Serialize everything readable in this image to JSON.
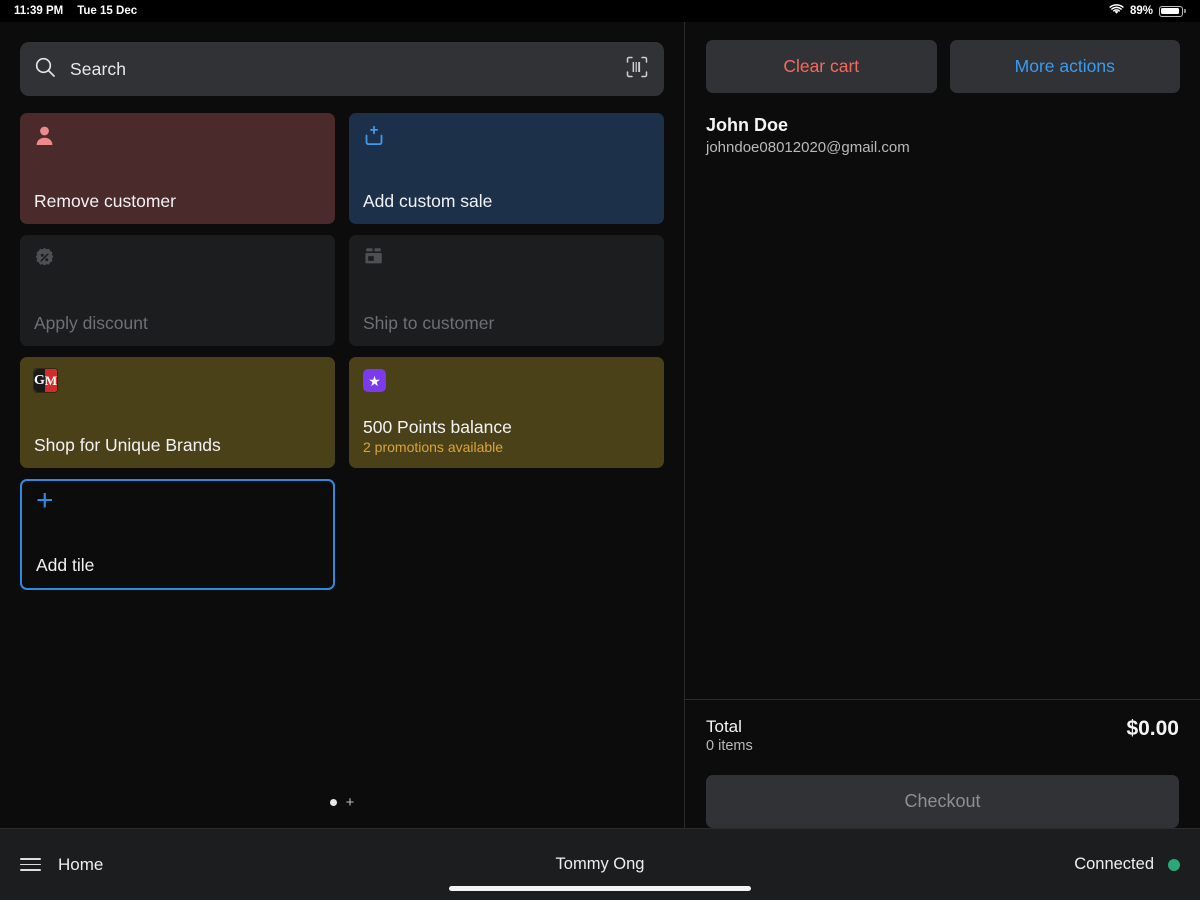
{
  "status_bar": {
    "time": "11:39 PM",
    "date": "Tue 15 Dec",
    "battery_percent": "89%",
    "wifi_icon": "wifi-icon",
    "battery_icon": "battery-icon"
  },
  "search": {
    "placeholder": "Search",
    "value": "",
    "search_icon": "search-icon",
    "scan_icon": "barcode-scan-icon"
  },
  "tiles": [
    {
      "id": "remove-customer",
      "label": "Remove customer",
      "sublabel": "",
      "icon": "person-icon",
      "bg": "#4a2a2a",
      "enabled": true
    },
    {
      "id": "add-custom-sale",
      "label": "Add custom sale",
      "sublabel": "",
      "icon": "add-to-cart-icon",
      "bg": "#1c3149",
      "enabled": true
    },
    {
      "id": "apply-discount",
      "label": "Apply discount",
      "sublabel": "",
      "icon": "percent-badge-icon",
      "bg": "#1b1d1f",
      "enabled": false
    },
    {
      "id": "ship-to-customer",
      "label": "Ship to customer",
      "sublabel": "",
      "icon": "package-box-icon",
      "bg": "#1b1d1f",
      "enabled": false
    },
    {
      "id": "shop-unique-brands",
      "label": "Shop for Unique Brands",
      "sublabel": "",
      "icon": "gm-logo-icon",
      "bg": "#4b4119",
      "enabled": true
    },
    {
      "id": "points-balance",
      "label": "500 Points balance",
      "sublabel": "2 promotions available",
      "sublabel_color": "#d9a43b",
      "icon": "star-badge-icon",
      "bg": "#4b4119",
      "enabled": true
    },
    {
      "id": "add-tile",
      "label": "Add tile",
      "sublabel": "",
      "icon": "plus-icon",
      "bg": "#0c0c0c",
      "border_color": "#2f8ae0",
      "enabled": true
    }
  ],
  "pager": {
    "dot_count": 1,
    "active_index": 0,
    "add_page_label": "+"
  },
  "cart": {
    "clear_label": "Clear cart",
    "clear_color": "#f8685e",
    "more_label": "More actions",
    "more_color": "#3a9bf0",
    "customer": {
      "name": "John Doe",
      "email": "johndoe08012020@gmail.com"
    },
    "totals": {
      "label": "Total",
      "items": "0 items",
      "amount": "$0.00"
    },
    "checkout_label": "Checkout",
    "checkout_enabled": false
  },
  "bottom_bar": {
    "menu_icon": "hamburger-menu-icon",
    "home_label": "Home",
    "user_label": "Tommy Ong",
    "connection_label": "Connected",
    "connection_color": "#2aa877"
  },
  "theme": {
    "background": "#0c0c0c",
    "surface": "#1b1d1f",
    "control": "#303235",
    "accent_blue": "#3a9bf0",
    "accent_red": "#f8685e",
    "divider": "#2b2b2b"
  }
}
